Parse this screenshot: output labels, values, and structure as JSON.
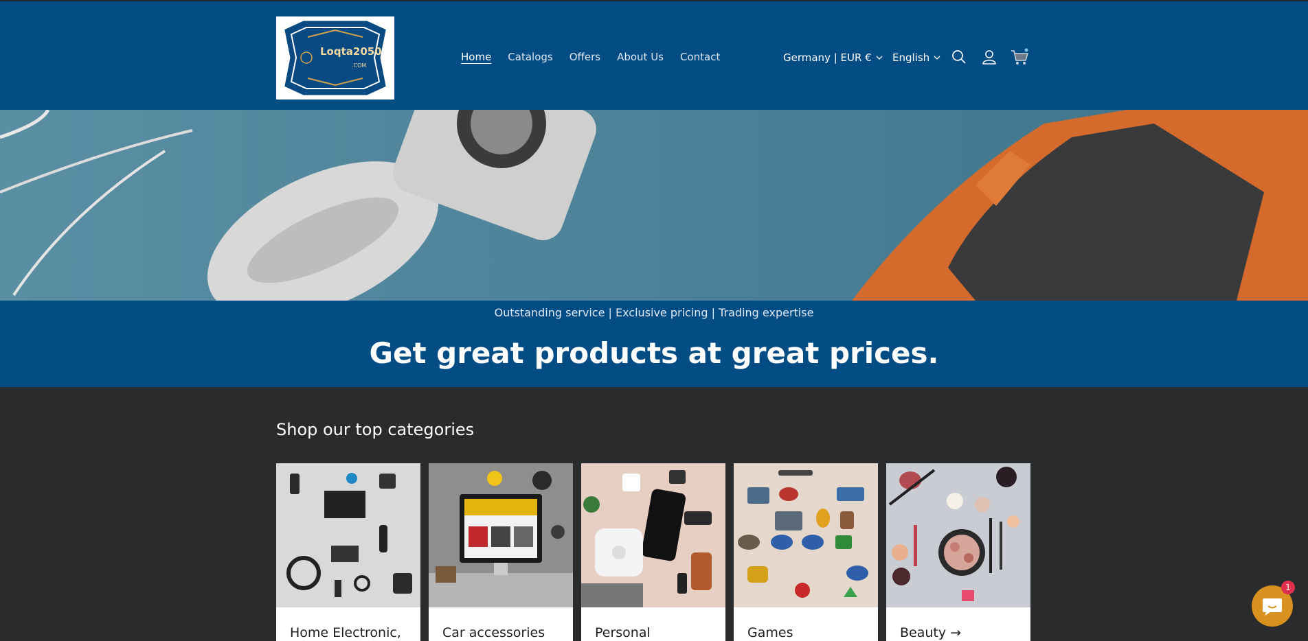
{
  "header": {
    "logo": {
      "name": "Loqta2050",
      "sub": ".COM"
    },
    "nav": [
      {
        "label": "Home"
      },
      {
        "label": "Catalogs"
      },
      {
        "label": "Offers"
      },
      {
        "label": "About Us"
      },
      {
        "label": "Contact"
      }
    ],
    "country_selector": "Germany | EUR €",
    "language_selector": "English",
    "icons": [
      "search-icon",
      "account-icon",
      "cart-icon"
    ]
  },
  "hero": {
    "tagline": "Outstanding service | Exclusive pricing | Trading expertise",
    "headline": "Get great products at great prices."
  },
  "categories": {
    "title": "Shop our top categories",
    "items": [
      {
        "label": "Home Electronic,"
      },
      {
        "label": "Car accessories"
      },
      {
        "label": "Personal"
      },
      {
        "label": "Games"
      },
      {
        "label": "Beauty →"
      }
    ]
  },
  "chat": {
    "badge_count": "1"
  },
  "colors": {
    "brand": "#034d84",
    "dark": "#2a2b2d",
    "chat": "#d9921f",
    "badge": "#e0304d"
  }
}
